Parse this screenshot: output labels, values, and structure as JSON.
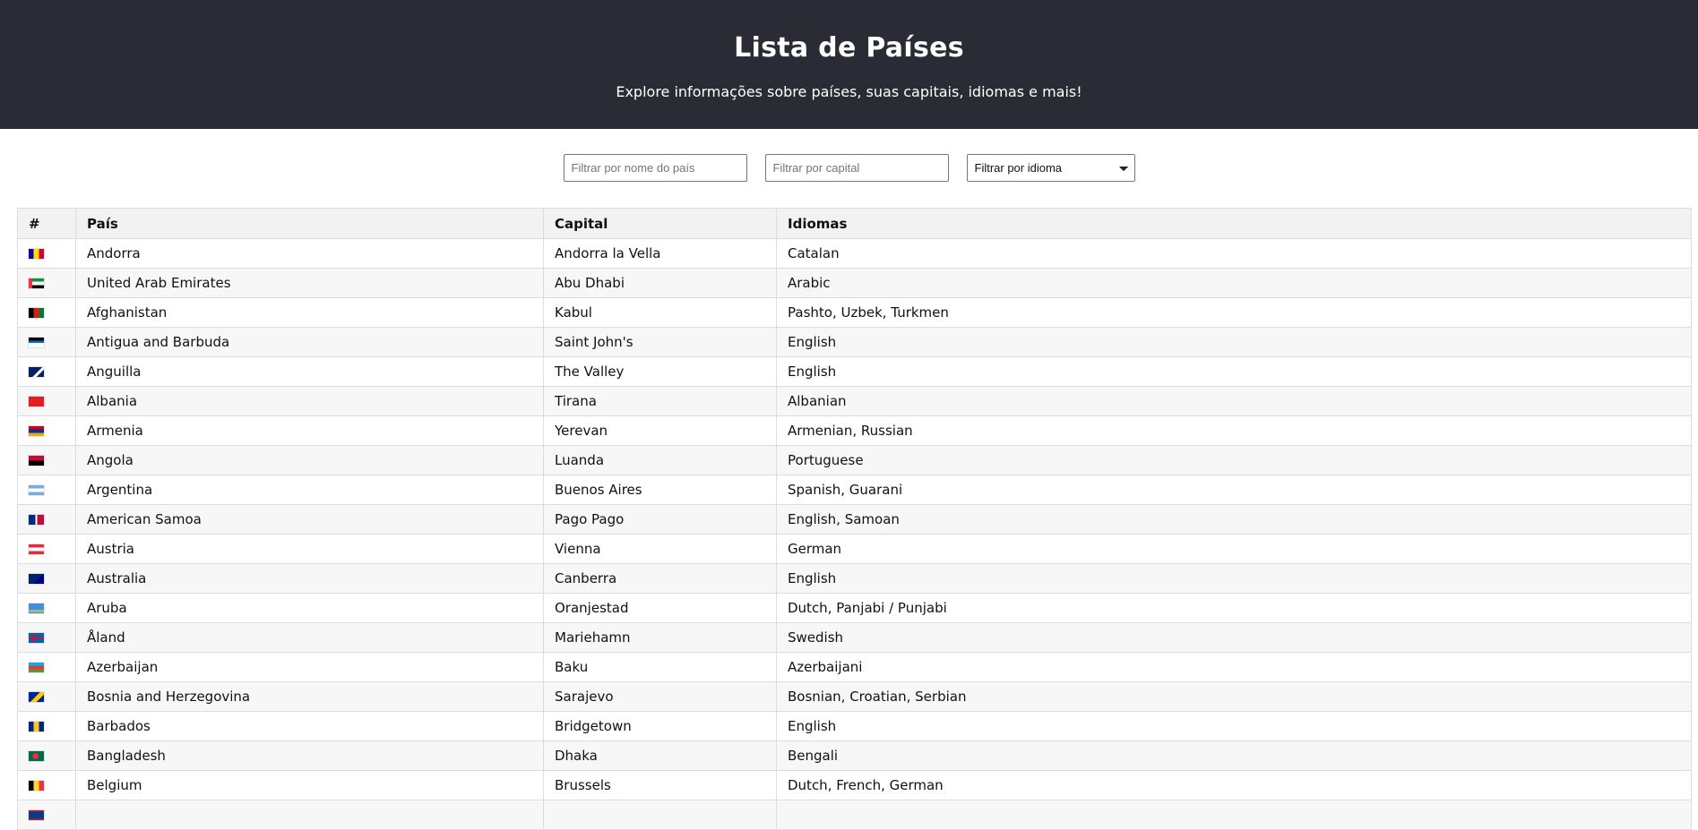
{
  "header": {
    "title": "Lista de Países",
    "subtitle": "Explore informações sobre países, suas capitais, idiomas e mais!"
  },
  "filters": {
    "country_placeholder": "Filtrar por nome do país",
    "capital_placeholder": "Filtrar por capital",
    "language_selected": "Filtrar por idioma"
  },
  "table": {
    "headers": [
      "#",
      "País",
      "Capital",
      "Idiomas"
    ],
    "rows": [
      {
        "flag": "flag-andorra",
        "country": "Andorra",
        "capital": "Andorra la Vella",
        "languages": "Catalan"
      },
      {
        "flag": "flag-united-arab-emirates",
        "country": "United Arab Emirates",
        "capital": "Abu Dhabi",
        "languages": "Arabic"
      },
      {
        "flag": "flag-afghanistan",
        "country": "Afghanistan",
        "capital": "Kabul",
        "languages": "Pashto, Uzbek, Turkmen"
      },
      {
        "flag": "flag-antigua-and-barbuda",
        "country": "Antigua and Barbuda",
        "capital": "Saint John's",
        "languages": "English"
      },
      {
        "flag": "flag-anguilla",
        "country": "Anguilla",
        "capital": "The Valley",
        "languages": "English"
      },
      {
        "flag": "flag-albania",
        "country": "Albania",
        "capital": "Tirana",
        "languages": "Albanian"
      },
      {
        "flag": "flag-armenia",
        "country": "Armenia",
        "capital": "Yerevan",
        "languages": "Armenian, Russian"
      },
      {
        "flag": "flag-angola",
        "country": "Angola",
        "capital": "Luanda",
        "languages": "Portuguese"
      },
      {
        "flag": "flag-argentina",
        "country": "Argentina",
        "capital": "Buenos Aires",
        "languages": "Spanish, Guarani"
      },
      {
        "flag": "flag-american-samoa",
        "country": "American Samoa",
        "capital": "Pago Pago",
        "languages": "English, Samoan"
      },
      {
        "flag": "flag-austria",
        "country": "Austria",
        "capital": "Vienna",
        "languages": "German"
      },
      {
        "flag": "flag-australia",
        "country": "Australia",
        "capital": "Canberra",
        "languages": "English"
      },
      {
        "flag": "flag-aruba",
        "country": "Aruba",
        "capital": "Oranjestad",
        "languages": "Dutch, Panjabi / Punjabi"
      },
      {
        "flag": "flag-aland",
        "country": "Åland",
        "capital": "Mariehamn",
        "languages": "Swedish"
      },
      {
        "flag": "flag-azerbaijan",
        "country": "Azerbaijan",
        "capital": "Baku",
        "languages": "Azerbaijani"
      },
      {
        "flag": "flag-bosnia-and-herzegovina",
        "country": "Bosnia and Herzegovina",
        "capital": "Sarajevo",
        "languages": "Bosnian, Croatian, Serbian"
      },
      {
        "flag": "flag-barbados",
        "country": "Barbados",
        "capital": "Bridgetown",
        "languages": "English"
      },
      {
        "flag": "flag-bangladesh",
        "country": "Bangladesh",
        "capital": "Dhaka",
        "languages": "Bengali"
      },
      {
        "flag": "flag-belgium",
        "country": "Belgium",
        "capital": "Brussels",
        "languages": "Dutch, French, German"
      },
      {
        "flag": "flag-belize",
        "country": "",
        "capital": "",
        "languages": ""
      }
    ]
  },
  "colors": {
    "header_bg": "#292c34",
    "header_text": "#ffffff",
    "row_alt_bg": "#f7f7f7",
    "thead_bg": "#f2f2f2",
    "border": "#dcdcdc"
  }
}
